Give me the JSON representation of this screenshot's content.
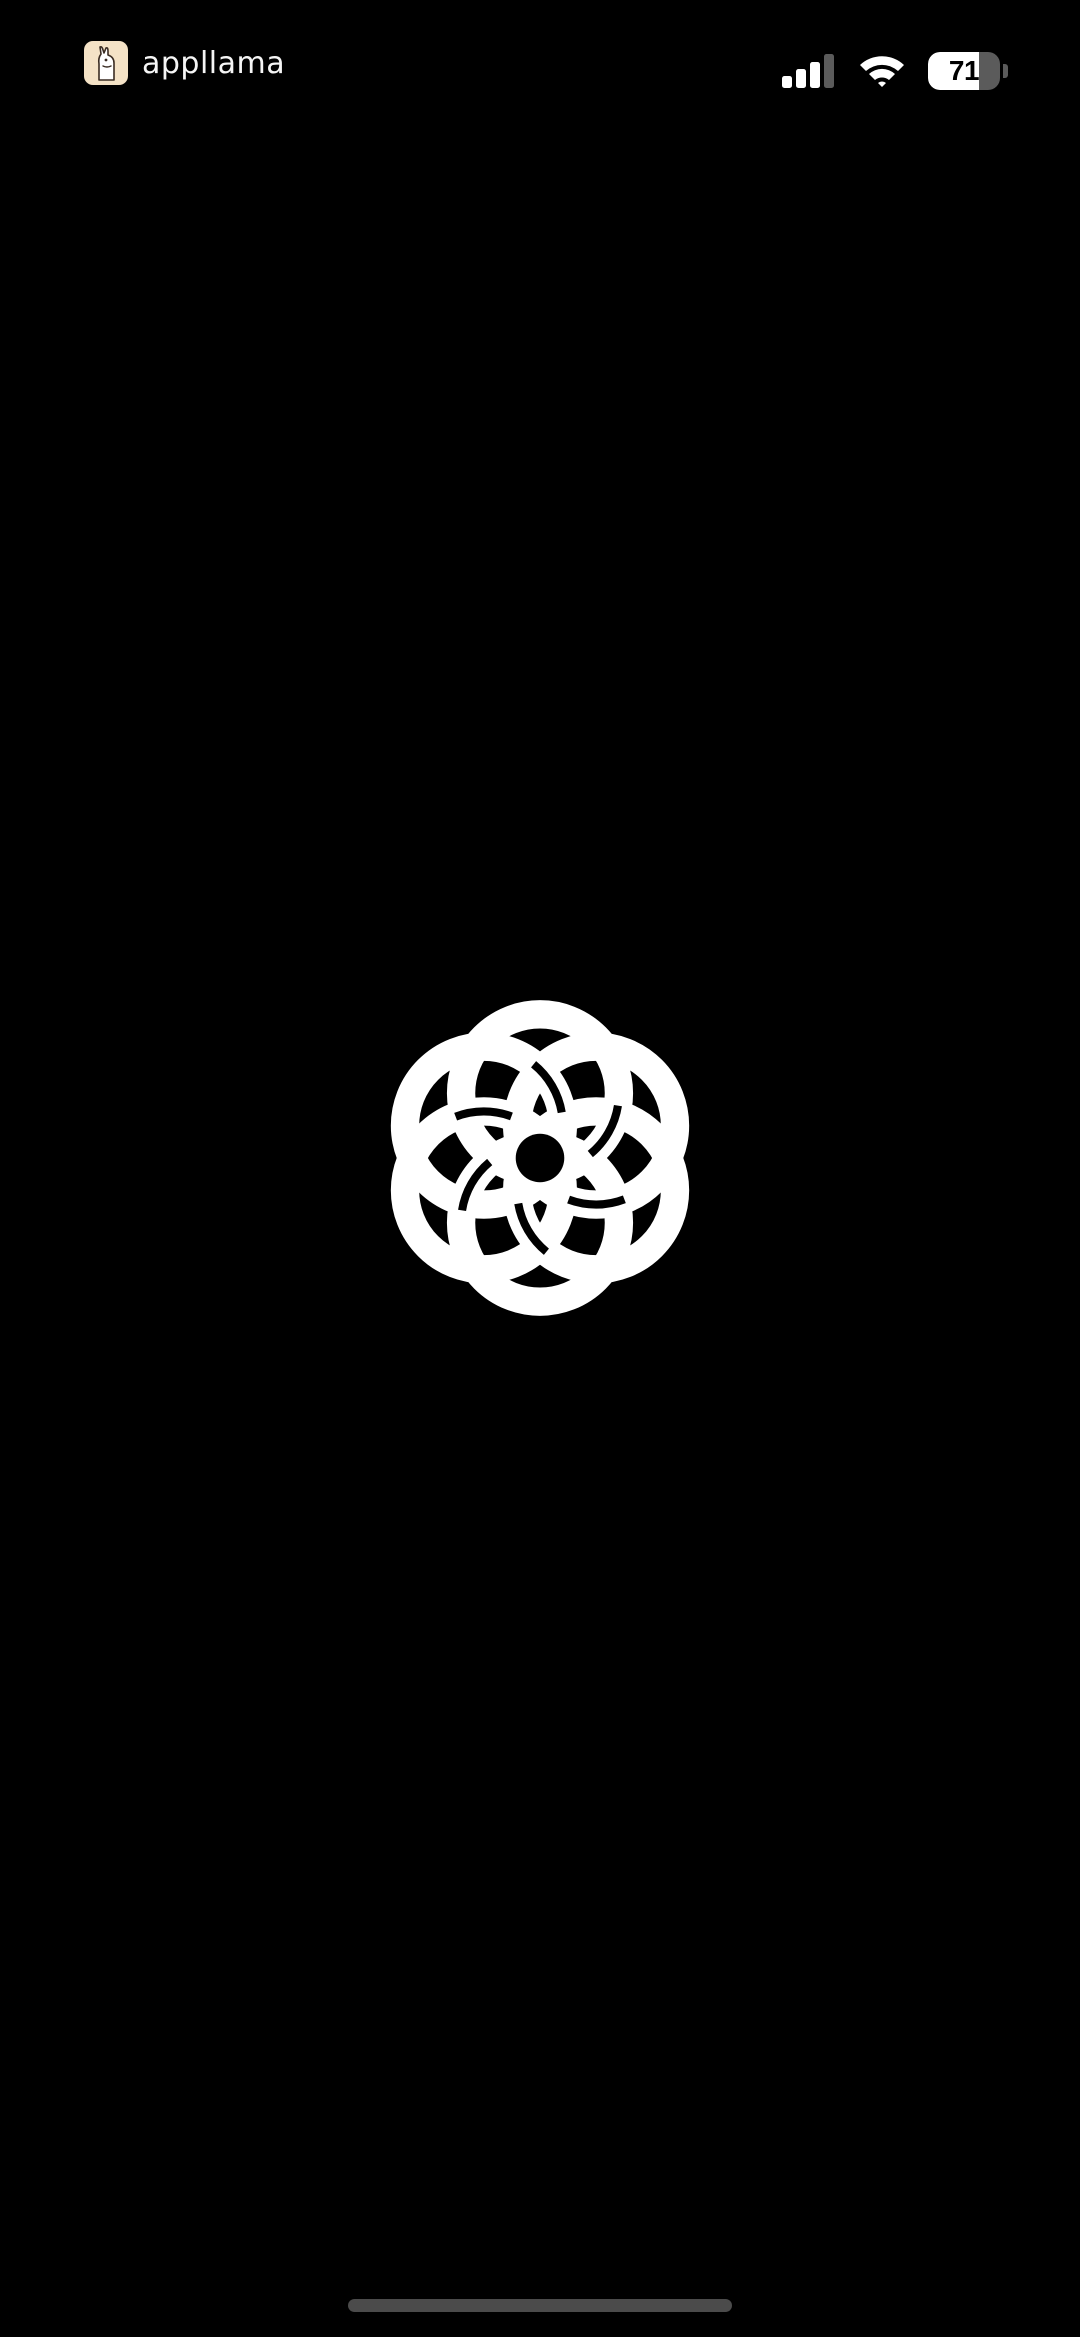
{
  "status_bar": {
    "brand_name": "appllama",
    "battery_percent": "71",
    "battery_level": 0.71,
    "signal_bars_active": 3,
    "signal_bars_total": 4
  },
  "splash": {
    "logo_icon": "interlocking-rings-icon"
  },
  "colors": {
    "background": "#000000",
    "foreground": "#ffffff",
    "brand_logo_bg": "#f4e2c6",
    "home_indicator": "#4b4b4b"
  }
}
